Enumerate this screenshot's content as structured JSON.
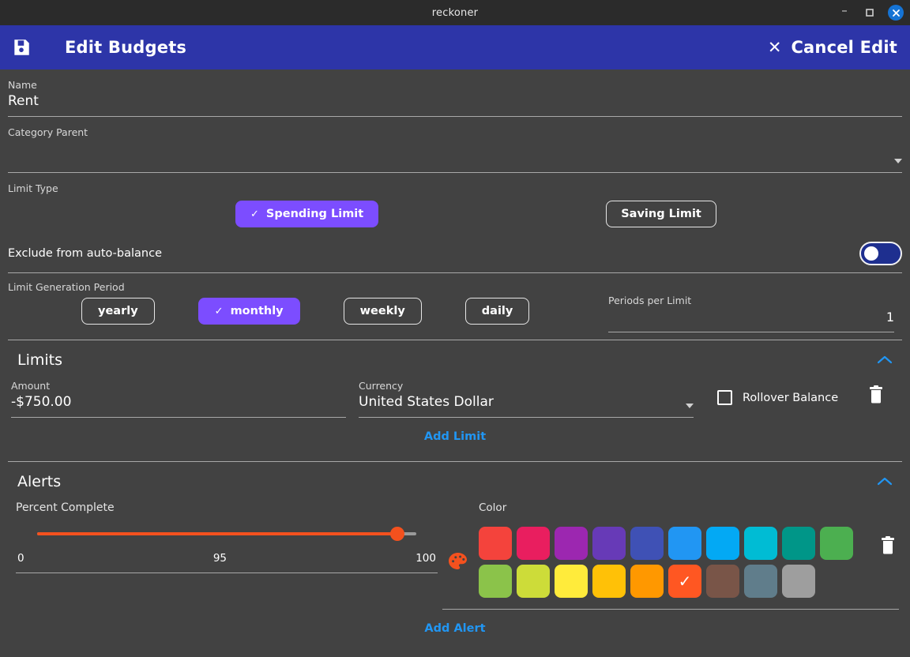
{
  "window": {
    "title": "reckoner",
    "controls": {
      "minimize": "minimize-icon",
      "maximize": "maximize-icon",
      "close": "close-icon"
    }
  },
  "appbar": {
    "save_icon": "save-icon",
    "title": "Edit Budgets",
    "cancel_x": "✕",
    "cancel_label": "Cancel Edit",
    "background": "#2d35a8"
  },
  "form": {
    "name": {
      "label": "Name",
      "value": "Rent"
    },
    "category_parent": {
      "label": "Category Parent",
      "value": "",
      "caret": "chevron-down-icon"
    },
    "limit_type": {
      "label": "Limit Type",
      "options": [
        {
          "label": "Spending Limit",
          "selected": true
        },
        {
          "label": "Saving Limit",
          "selected": false
        }
      ]
    },
    "exclude_auto_balance": {
      "label": "Exclude from auto-balance",
      "value": "on"
    },
    "limit_generation_period": {
      "label": "Limit Generation Period",
      "options": [
        {
          "label": "yearly",
          "selected": false
        },
        {
          "label": "monthly",
          "selected": true
        },
        {
          "label": "weekly",
          "selected": false
        },
        {
          "label": "daily",
          "selected": false
        }
      ]
    },
    "periods_per_limit": {
      "label": "Periods per Limit",
      "value": "1"
    }
  },
  "limits_section": {
    "title": "Limits",
    "collapse_icon": "chevron-up-icon",
    "rows": [
      {
        "amount_label": "Amount",
        "amount_value": "-$750.00",
        "currency_label": "Currency",
        "currency_value": "United States Dollar",
        "rollover_label": "Rollover Balance",
        "rollover_checked": false,
        "delete_icon": "trash-icon"
      }
    ],
    "add_label": "Add Limit"
  },
  "alerts_section": {
    "title": "Alerts",
    "collapse_icon": "chevron-up-icon",
    "rows": [
      {
        "percent_label": "Percent Complete",
        "percent_value": "95",
        "percent_min": "0",
        "percent_max": "100",
        "palette_icon": "palette-icon",
        "color_label": "Color",
        "selected_color": "#ff5722",
        "delete_icon": "trash-icon"
      }
    ],
    "add_label": "Add Alert"
  },
  "color_palette": {
    "row1": [
      "#f4433c",
      "#e91e5f",
      "#9c27b0",
      "#673ab7",
      "#3f51b5",
      "#2196f3",
      "#03a9f4",
      "#00bcd4",
      "#009688",
      "#4caf50"
    ],
    "row2": [
      "#8bc34a",
      "#cddc39",
      "#ffeb3b",
      "#ffc107",
      "#ff9800",
      "#ff5722",
      "#795548",
      "#607d8b",
      "#9e9e9e"
    ]
  },
  "theme": {
    "accent_purple": "#7c4dff",
    "link_blue": "#2196f3",
    "background": "#424242",
    "titlebar": "#2b2b2b",
    "slider_orange": "#f4511e"
  }
}
